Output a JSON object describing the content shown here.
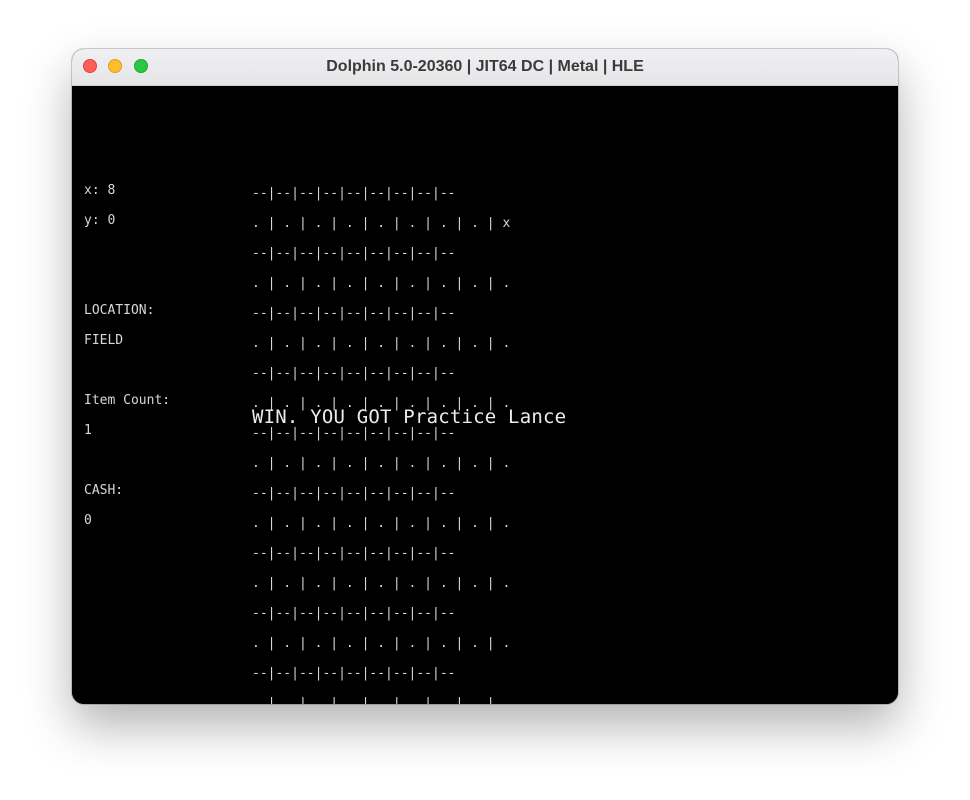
{
  "window": {
    "title": "Dolphin 5.0-20360 | JIT64 DC | Metal | HLE"
  },
  "hud": {
    "x_line": "x: 8",
    "y_line": "y: 0",
    "location_label": "LOCATION:",
    "location_value": "FIELD",
    "item_count_label": "Item Count:",
    "item_count_value": "1",
    "cash_label": "CASH:",
    "cash_value": "0"
  },
  "grid": {
    "rows": [
      "--|--|--|--|--|--|--|--|--",
      ". | . | . | . | . | . | . | . | x",
      "--|--|--|--|--|--|--|--|--",
      ". | . | . | . | . | . | . | . | .",
      "--|--|--|--|--|--|--|--|--",
      ". | . | . | . | . | . | . | . | .",
      "--|--|--|--|--|--|--|--|--",
      ". | . | . | . | . | . | . | . | .",
      "--|--|--|--|--|--|--|--|--",
      ". | . | . | . | . | . | . | . | .",
      "--|--|--|--|--|--|--|--|--",
      ". | . | . | . | . | . | . | . | .",
      "--|--|--|--|--|--|--|--|--",
      ". | . | . | . | . | . | . | . | .",
      "--|--|--|--|--|--|--|--|--",
      ". | . | . | . | . | . | . | . | .",
      "--|--|--|--|--|--|--|--|--",
      ". | . | . | . | . | . | . | . | ."
    ]
  },
  "message": "WIN. YOU GOT Practice Lance",
  "colors": {
    "close": "#fe5f57",
    "minimize": "#febc2e",
    "zoom": "#28c840",
    "screen_bg": "#000000",
    "text": "#d8d8d8"
  }
}
